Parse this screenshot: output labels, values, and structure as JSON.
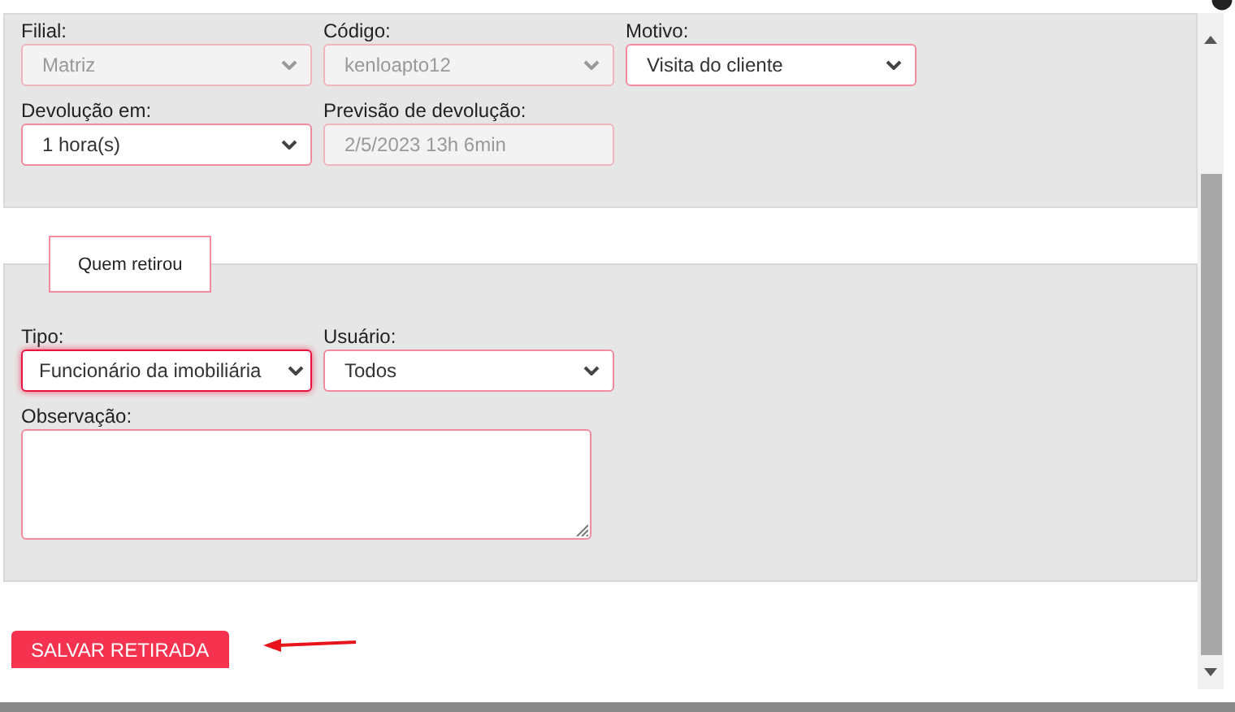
{
  "sections": [
    {
      "rows": [
        [
          {
            "label": "Filial:",
            "kind": "select",
            "value": "Matriz",
            "disabled": true,
            "focused": false
          },
          {
            "label": "Código:",
            "kind": "select",
            "value": "kenloapto12",
            "disabled": true,
            "focused": false
          },
          {
            "label": "Motivo:",
            "kind": "select",
            "value": "Visita do cliente",
            "disabled": false,
            "focused": false
          }
        ],
        [
          {
            "label": "Devolução em:",
            "kind": "select",
            "value": "1 hora(s)",
            "disabled": false,
            "focused": false
          },
          {
            "label": "Previsão de devolução:",
            "kind": "input",
            "value": "2/5/2023 13h 6min",
            "disabled": true,
            "focused": false
          }
        ]
      ]
    },
    {
      "tab": "Quem retirou",
      "rows": [
        [
          {
            "label": "Tipo:",
            "kind": "select",
            "value": "Funcionário da imobiliária",
            "disabled": false,
            "focused": true
          },
          {
            "label": "Usuário:",
            "kind": "select",
            "value": "Todos",
            "disabled": false,
            "focused": false
          }
        ],
        [
          {
            "label": "Observação:",
            "kind": "textarea",
            "disabled": false,
            "focused": false
          }
        ]
      ]
    }
  ],
  "save_button": "SALVAR RETIRADA"
}
